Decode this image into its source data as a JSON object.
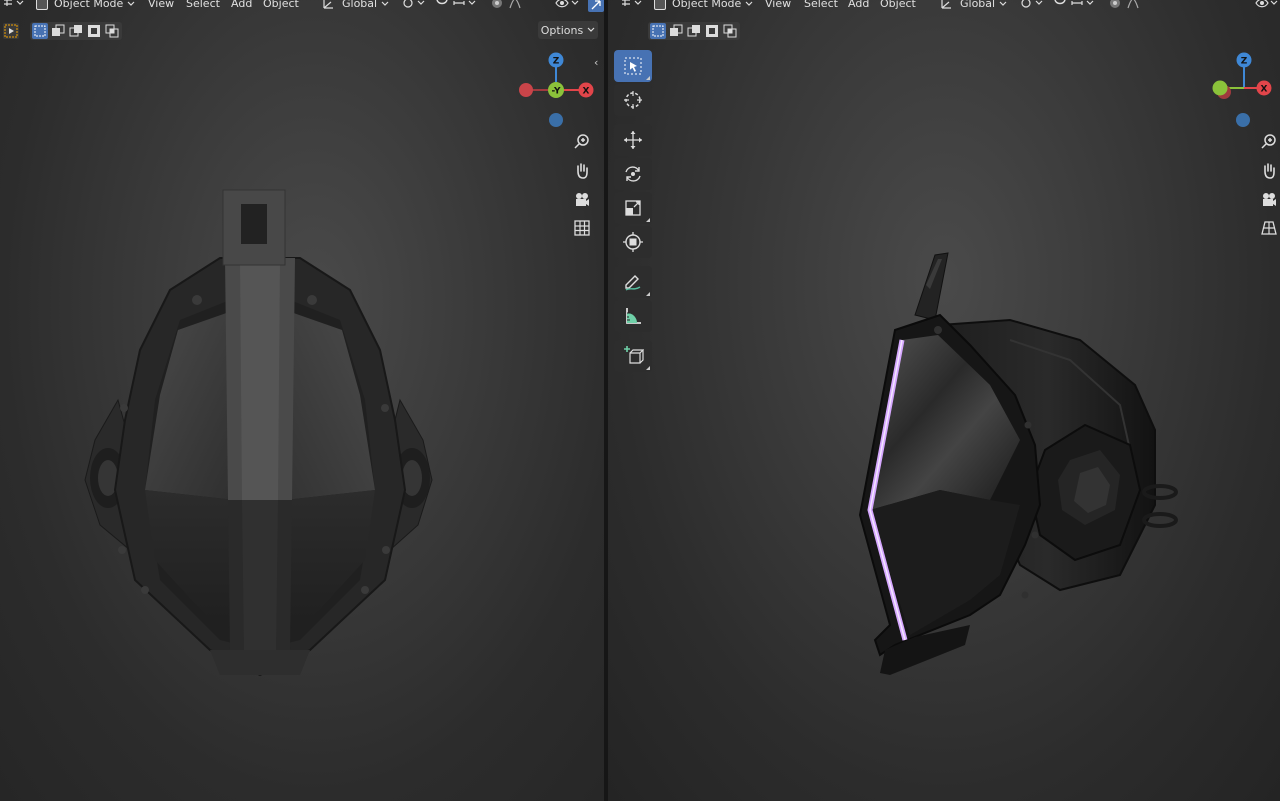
{
  "left_header": {
    "mode_label": "Object Mode",
    "menus": [
      "View",
      "Select",
      "Add",
      "Object"
    ],
    "transform_orientation": "Global",
    "options_label": "Options"
  },
  "right_header": {
    "mode_label": "Object Mode",
    "menus": [
      "View",
      "Select",
      "Add",
      "Object"
    ],
    "transform_orientation": "Global"
  },
  "gizmo_left": {
    "top_axis": "Z",
    "center_axis": "-Y",
    "right_axis": "X"
  },
  "gizmo_right": {
    "top_axis": "Z",
    "right_axis": "X"
  },
  "colors": {
    "x_axis": "#e2454a",
    "y_axis": "#8bc23a",
    "z_axis": "#3f88d6",
    "active_tool": "#4772b3",
    "glow": "#d6a8ff"
  },
  "toolbar_icons": [
    "select-box-icon",
    "cursor-icon",
    "move-icon",
    "rotate-icon",
    "scale-icon",
    "transform-icon",
    "annotate-icon",
    "measure-icon",
    "add-cube-icon"
  ],
  "nav_icons": [
    "zoom-icon",
    "pan-hand-icon",
    "camera-icon",
    "grid-icon"
  ]
}
